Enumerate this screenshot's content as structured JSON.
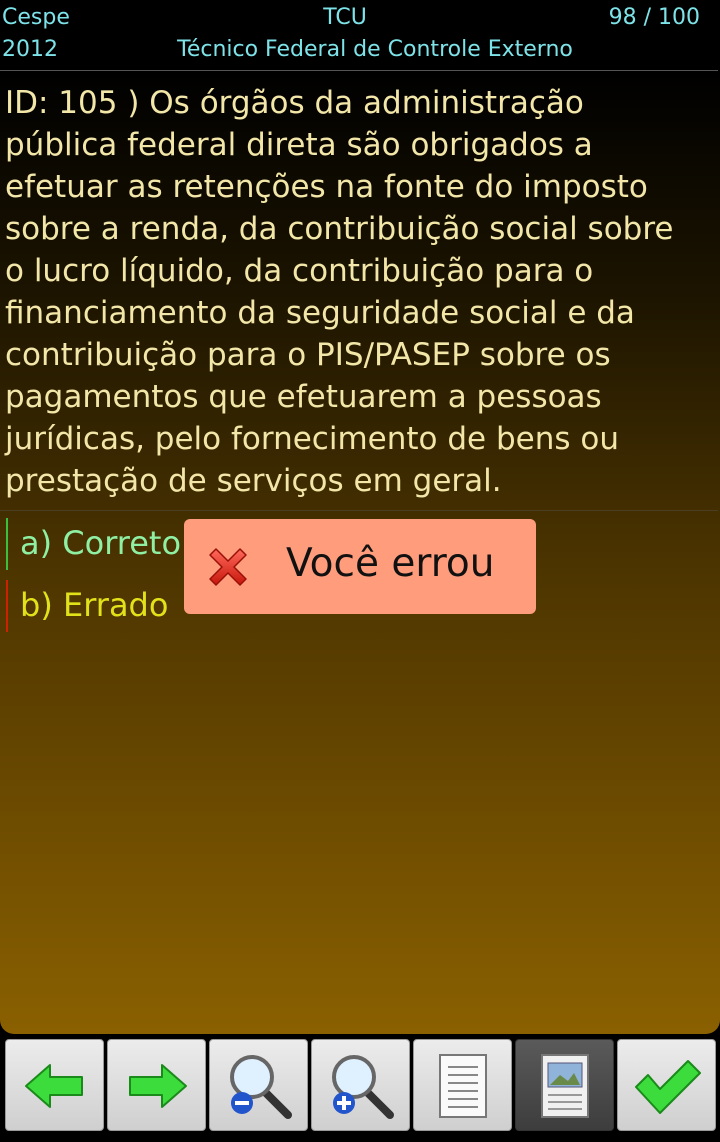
{
  "header": {
    "banca": "Cespe",
    "orgao": "TCU",
    "contador": "98 / 100",
    "ano": "2012",
    "cargo": "Técnico Federal de Controle Externo"
  },
  "question": {
    "lines": [
      "ID: 105 ) Os órgãos da administração",
      "pública federal direta são obrigados a",
      "efetuar as retenções na fonte do imposto",
      "sobre a renda, da contribuição social sobre",
      "o lucro líquido, da contribuição para o",
      "financiamento da seguridade social e da",
      "contribuição para o PIS/PASEP sobre os",
      "pagamentos que efetuarem a pessoas",
      "jurídicas, pelo fornecimento de bens ou",
      "prestação de serviços em geral."
    ]
  },
  "options": {
    "a": "a) Correto",
    "b": "b) Errado"
  },
  "toast": {
    "text": "Você errou",
    "icon": "red-x-icon"
  },
  "toolbar": {
    "icons": [
      "arrow-left-icon",
      "arrow-right-icon",
      "zoom-out-icon",
      "zoom-in-icon",
      "document-icon",
      "document-image-icon",
      "checkmark-icon"
    ]
  },
  "colors": {
    "header_text": "#7ee3e8",
    "question_text": "#f2e6a8",
    "option_correct": "#8ff0a4",
    "option_wrong": "#e2e21a",
    "toast_bg": "#fe9c7c"
  }
}
